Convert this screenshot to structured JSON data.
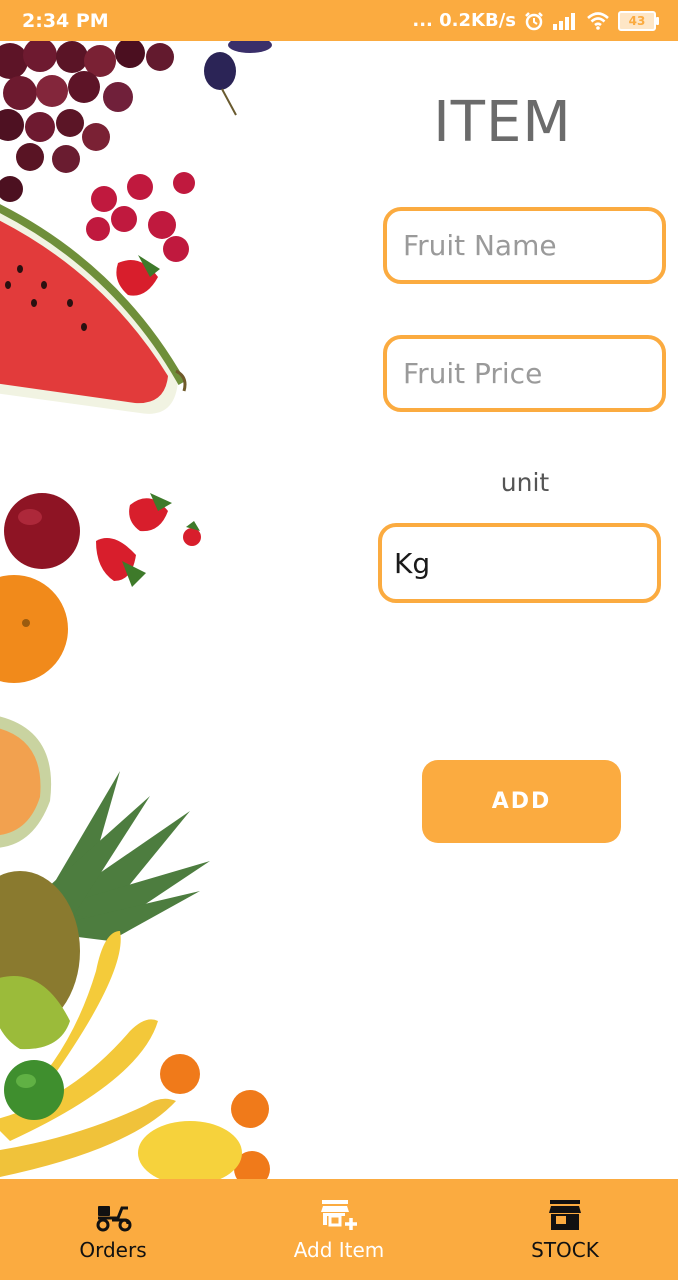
{
  "status_bar": {
    "time": "2:34 PM",
    "network_speed": "... 0.2KB/s",
    "battery": "43"
  },
  "form": {
    "title": "ITEM",
    "fruit_name_placeholder": "Fruit Name",
    "fruit_price_placeholder": "Fruit Price",
    "unit_label": "unit",
    "unit_value": "Kg",
    "add_label": "ADD"
  },
  "bottom_nav": {
    "items": [
      {
        "label": "Orders",
        "icon": "scooter-icon"
      },
      {
        "label": "Add Item",
        "icon": "add-store-icon"
      },
      {
        "label": "STOCK",
        "icon": "store-icon"
      }
    ]
  },
  "colors": {
    "accent": "#fbab40",
    "title": "#6b6b6b",
    "placeholder": "#9a9a9a"
  }
}
